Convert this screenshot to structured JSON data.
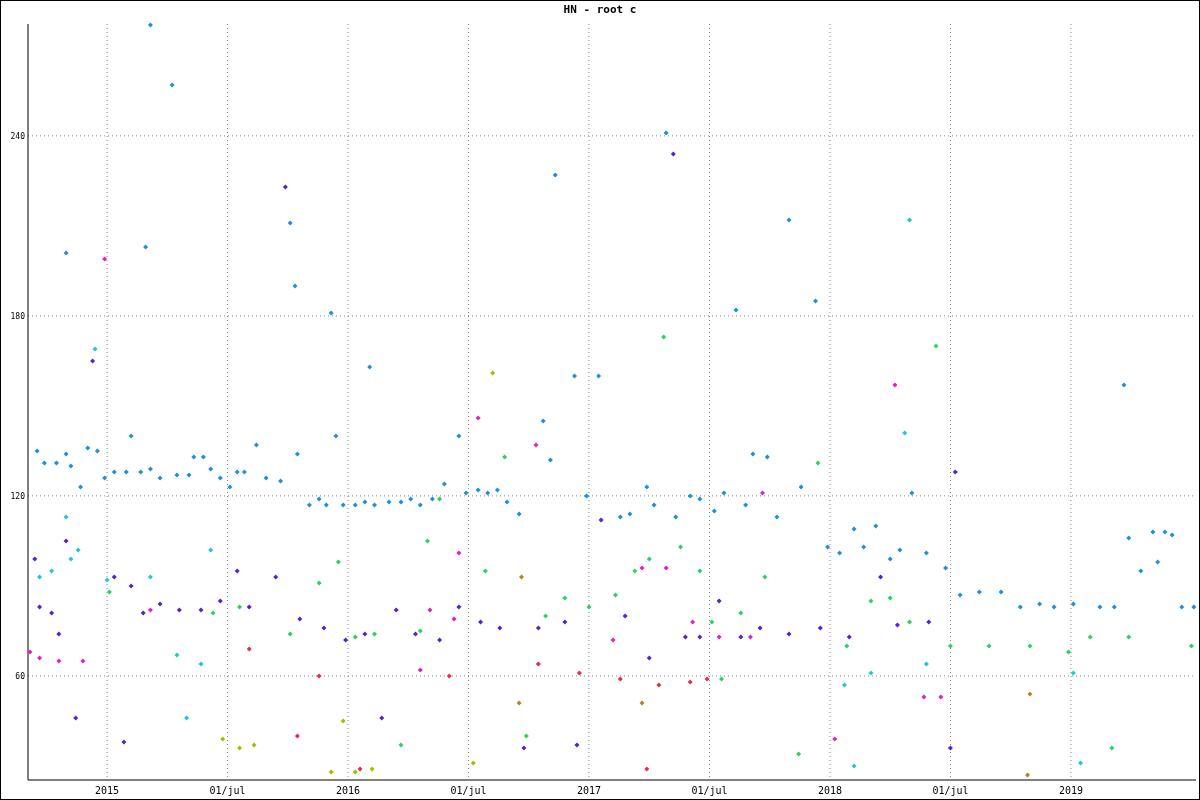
{
  "chart_data": {
    "type": "scatter",
    "title": "HN - root c",
    "xlim": [
      2014.672,
      2019.519
    ],
    "ylim": [
      25.3,
      277.3
    ],
    "xticks": [
      {
        "value": 2015,
        "label": "2015"
      },
      {
        "value": 2015.5,
        "label": "01/jul"
      },
      {
        "value": 2016,
        "label": "2016"
      },
      {
        "value": 2016.5,
        "label": "01/jul"
      },
      {
        "value": 2017,
        "label": "2017"
      },
      {
        "value": 2017.5,
        "label": "01/jul"
      },
      {
        "value": 2018,
        "label": "2018"
      },
      {
        "value": 2018.5,
        "label": "01/jul"
      },
      {
        "value": 2019,
        "label": "2019"
      }
    ],
    "yticks": [
      60,
      120,
      180,
      240
    ],
    "grid": true,
    "series": [
      {
        "color": "#2090d8",
        "x": [
          2014.71,
          2014.74,
          2014.79,
          2014.83,
          2014.85,
          2014.89,
          2014.92,
          2014.96,
          2014.99,
          2015.03,
          2015.08,
          2015.1,
          2015.14,
          2015.18,
          2015.22,
          2015.29,
          2015.34,
          2015.36,
          2015.4,
          2015.43,
          2015.47,
          2015.51,
          2015.54,
          2015.57,
          2015.62,
          2015.66,
          2015.72,
          2015.79,
          2015.84,
          2015.88,
          2015.91,
          2015.95,
          2015.98,
          2016.03,
          2016.07,
          2016.11,
          2016.17,
          2016.22,
          2016.26,
          2016.3,
          2016.35,
          2016.4,
          2016.46,
          2016.49,
          2016.54,
          2016.58,
          2016.62,
          2016.66,
          2016.71,
          2016.81,
          2016.84,
          2016.94,
          2016.99,
          2017.04,
          2017.13,
          2017.17,
          2017.24,
          2017.27,
          2017.32,
          2017.36,
          2017.42,
          2017.46,
          2017.52,
          2017.56,
          2017.61,
          2017.65,
          2017.68,
          2017.74,
          2017.78,
          2017.83,
          2017.88,
          2017.94,
          2017.99,
          2018.04,
          2018.1,
          2018.14,
          2018.19,
          2018.25,
          2018.29,
          2018.34,
          2018.4,
          2018.48,
          2018.54,
          2018.62,
          2018.71,
          2018.79,
          2018.87,
          2018.93,
          2019.01,
          2019.12,
          2019.18,
          2019.22,
          2019.24,
          2019.29,
          2019.34,
          2019.36,
          2019.39,
          2019.42,
          2019.46,
          2019.51,
          2014.83,
          2015.18,
          2015.16,
          2015.27,
          2015.76,
          2015.78,
          2015.93,
          2016.09,
          2016.86
        ],
        "values": [
          135,
          131,
          131,
          134,
          130,
          123,
          136,
          135,
          126,
          128,
          128,
          140,
          128,
          129,
          126,
          127,
          127,
          133,
          133,
          129,
          126,
          123,
          128,
          128,
          137,
          126,
          125,
          134,
          117,
          119,
          117,
          140,
          117,
          117,
          118,
          117,
          118,
          118,
          119,
          117,
          119,
          124,
          140,
          121,
          122,
          121,
          122,
          118,
          114,
          145,
          132,
          160,
          120,
          160,
          113,
          114,
          123,
          117,
          241,
          113,
          120,
          119,
          115,
          121,
          182,
          117,
          134,
          133,
          113,
          212,
          123,
          185,
          103,
          101,
          109,
          103,
          110,
          99,
          102,
          121,
          101,
          96,
          87,
          88,
          88,
          83,
          84,
          83,
          84,
          83,
          83,
          157,
          106,
          95,
          108,
          98,
          108,
          107,
          83,
          83,
          201,
          277,
          203,
          257,
          211,
          190,
          181,
          163,
          227
        ]
      },
      {
        "color": "#5522d0",
        "x": [
          2014.7,
          2014.72,
          2014.77,
          2014.8,
          2014.83,
          2014.87,
          2014.94,
          2015.03,
          2015.07,
          2015.1,
          2015.15,
          2015.22,
          2015.3,
          2015.39,
          2015.47,
          2015.54,
          2015.59,
          2015.7,
          2015.74,
          2015.8,
          2015.9,
          2015.99,
          2016.07,
          2016.14,
          2016.2,
          2016.28,
          2016.38,
          2016.46,
          2016.55,
          2016.63,
          2016.73,
          2016.79,
          2016.9,
          2016.95,
          2017.05,
          2017.15,
          2017.25,
          2017.35,
          2017.4,
          2017.46,
          2017.54,
          2017.63,
          2017.71,
          2017.83,
          2017.96,
          2018.08,
          2018.21,
          2018.28,
          2018.41,
          2018.5,
          2018.52
        ],
        "values": [
          99,
          83,
          81,
          74,
          105,
          46,
          165,
          93,
          38,
          90,
          81,
          84,
          82,
          82,
          85,
          95,
          83,
          93,
          223,
          79,
          76,
          72,
          74,
          46,
          82,
          74,
          72,
          83,
          78,
          76,
          36,
          76,
          78,
          37,
          112,
          80,
          66,
          234,
          73,
          73,
          85,
          73,
          76,
          74,
          76,
          73,
          93,
          77,
          78,
          36,
          128
        ]
      },
      {
        "color": "#30d060",
        "x": [
          2015.01,
          2015.44,
          2015.55,
          2015.76,
          2015.88,
          2015.96,
          2016.03,
          2016.11,
          2016.22,
          2016.3,
          2016.33,
          2016.38,
          2016.57,
          2016.65,
          2016.74,
          2016.82,
          2016.9,
          2017.0,
          2017.11,
          2017.19,
          2017.25,
          2017.31,
          2017.38,
          2017.46,
          2017.51,
          2017.55,
          2017.63,
          2017.73,
          2017.87,
          2017.95,
          2018.07,
          2018.17,
          2018.25,
          2018.33,
          2018.44,
          2018.5,
          2018.66,
          2018.83,
          2018.99,
          2019.08,
          2019.17,
          2019.24,
          2019.5
        ],
        "values": [
          88,
          81,
          83,
          74,
          91,
          98,
          73,
          74,
          37,
          75,
          105,
          119,
          95,
          133,
          40,
          80,
          86,
          83,
          87,
          95,
          99,
          173,
          103,
          95,
          78,
          59,
          81,
          93,
          34,
          131,
          70,
          85,
          86,
          78,
          170,
          70,
          70,
          70,
          68,
          73,
          36,
          73,
          70
        ]
      },
      {
        "color": "#e020c8",
        "x": [
          2014.68,
          2014.72,
          2014.8,
          2014.9,
          2014.99,
          2015.18,
          2016.3,
          2016.34,
          2016.44,
          2016.46,
          2016.54,
          2016.78,
          2017.1,
          2017.22,
          2017.32,
          2017.43,
          2017.54,
          2017.67,
          2017.72,
          2018.02,
          2018.27,
          2018.39,
          2018.46
        ],
        "values": [
          68,
          66,
          65,
          65,
          199,
          82,
          62,
          82,
          79,
          101,
          146,
          137,
          72,
          96,
          96,
          78,
          73,
          73,
          121,
          39,
          157,
          53,
          53
        ]
      },
      {
        "color": "#e03050",
        "x": [
          2015.59,
          2015.79,
          2015.88,
          2016.05,
          2016.42,
          2016.79,
          2016.96,
          2017.13,
          2017.24,
          2017.29,
          2017.42,
          2017.49
        ],
        "values": [
          69,
          40,
          60,
          29,
          60,
          64,
          61,
          59,
          29,
          57,
          58,
          59
        ]
      },
      {
        "color": "#a0c000",
        "x": [
          2015.48,
          2015.55,
          2015.61,
          2015.93,
          2015.98,
          2016.03,
          2016.1,
          2016.52,
          2016.6
        ],
        "values": [
          39,
          36,
          37,
          28,
          45,
          28,
          29,
          31,
          161
        ]
      },
      {
        "color": "#20c8d0",
        "x": [
          2014.72,
          2014.77,
          2014.83,
          2014.85,
          2014.88,
          2014.95,
          2015.0,
          2015.18,
          2015.29,
          2015.33,
          2015.39,
          2015.43,
          2018.06,
          2018.1,
          2018.17,
          2018.33,
          2018.31,
          2018.4,
          2019.01,
          2019.04
        ],
        "values": [
          93,
          95,
          113,
          99,
          102,
          169,
          92,
          93,
          67,
          46,
          64,
          102,
          57,
          30,
          61,
          212,
          141,
          64,
          61,
          31
        ]
      },
      {
        "color": "#c08020",
        "x": [
          2016.71,
          2016.72,
          2017.22,
          2018.82,
          2018.83
        ],
        "values": [
          51,
          93,
          51,
          27,
          54
        ]
      }
    ]
  }
}
